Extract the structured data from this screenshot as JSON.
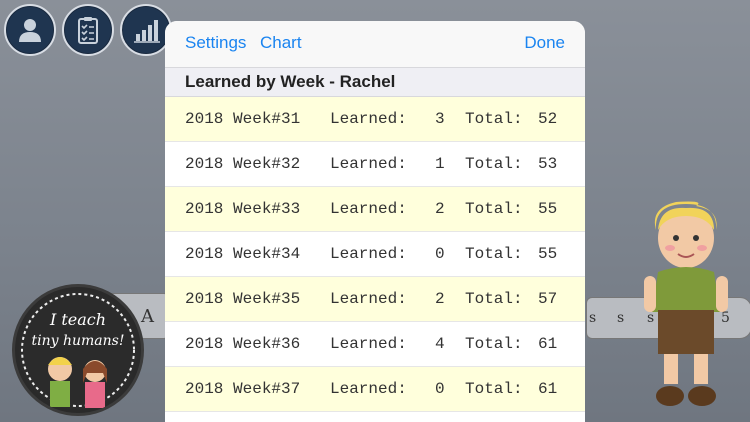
{
  "toolbar": {
    "icons": [
      "user-icon",
      "clipboard-checklist-icon",
      "bar-chart-icon"
    ]
  },
  "background": {
    "scroll_left_text": "A",
    "scroll_right_texts": [
      "s",
      "s",
      "s",
      "5"
    ],
    "logo_text_line1": "I teach",
    "logo_text_line2": "tiny humans!"
  },
  "modal": {
    "nav": {
      "settings": "Settings",
      "chart": "Chart",
      "done": "Done"
    },
    "section_title": "Learned by Week - Rachel",
    "rows": [
      {
        "week": "2018 Week#31",
        "learned_label": "Learned:",
        "learned": "3",
        "total_label": "Total:",
        "total": "52"
      },
      {
        "week": "2018 Week#32",
        "learned_label": "Learned:",
        "learned": "1",
        "total_label": "Total:",
        "total": "53"
      },
      {
        "week": "2018 Week#33",
        "learned_label": "Learned:",
        "learned": "2",
        "total_label": "Total:",
        "total": "55"
      },
      {
        "week": "2018 Week#34",
        "learned_label": "Learned:",
        "learned": "0",
        "total_label": "Total:",
        "total": "55"
      },
      {
        "week": "2018 Week#35",
        "learned_label": "Learned:",
        "learned": "2",
        "total_label": "Total:",
        "total": "57"
      },
      {
        "week": "2018 Week#36",
        "learned_label": "Learned:",
        "learned": "4",
        "total_label": "Total:",
        "total": "61"
      },
      {
        "week": "2018 Week#37",
        "learned_label": "Learned:",
        "learned": "0",
        "total_label": "Total:",
        "total": "61"
      }
    ]
  },
  "colors": {
    "accent": "#1a84f0",
    "highlight_row": "#ffffdc",
    "icon_bg": "#1f3550"
  }
}
